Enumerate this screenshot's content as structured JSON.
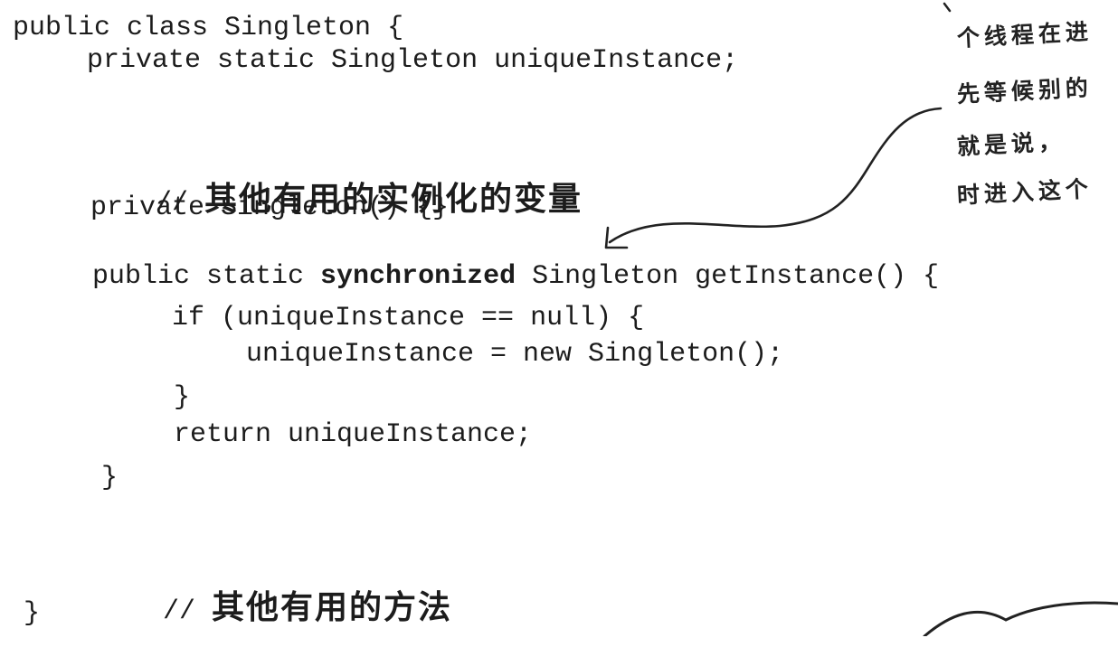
{
  "code": {
    "class_header": "public class Singleton {",
    "field_decl": "private static Singleton uniqueInstance;",
    "comment_fields": {
      "marker": "// ",
      "text": "其他有用的实例化的变量"
    },
    "constructor": "private Singleton() {}",
    "method_signature": {
      "prefix": "public static ",
      "keyword": "synchronized",
      "suffix": " Singleton getInstance() {"
    },
    "if_line": "if (uniqueInstance == null) {",
    "assign_line": "uniqueInstance = new Singleton();",
    "if_close": "}",
    "return_line": "return uniqueInstance;",
    "method_close": "}",
    "comment_methods": {
      "marker": "// ",
      "text": "其他有用的方法"
    },
    "class_close": "}"
  },
  "annotation": {
    "lines": [
      "个线程在进",
      "先等候别的",
      "就是说，",
      "时进入这个"
    ]
  }
}
